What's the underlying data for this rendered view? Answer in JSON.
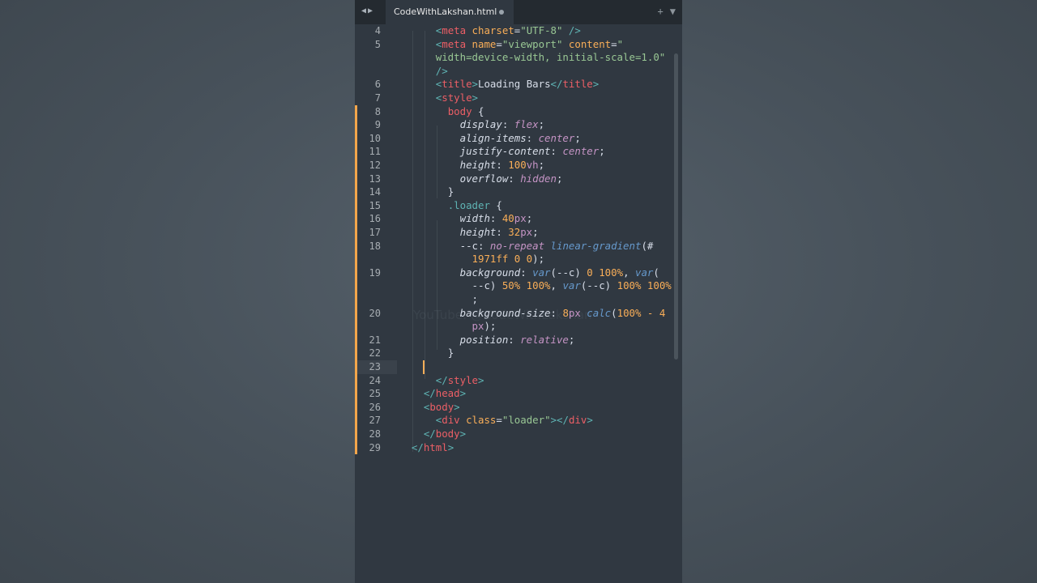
{
  "tab": {
    "filename": "CodeWithLakshan.html"
  },
  "watermark": "YouTube: @CodeWithLakshan",
  "lines": [
    {
      "n": "4",
      "tokens": [
        [
          "      ",
          "w"
        ],
        [
          "<",
          "p"
        ],
        [
          "meta",
          "t"
        ],
        [
          " charset",
          "a"
        ],
        [
          "=",
          "w"
        ],
        [
          "\"UTF-8\"",
          "s"
        ],
        [
          " />",
          "p"
        ]
      ]
    },
    {
      "n": "5",
      "tokens": [
        [
          "      ",
          "w"
        ],
        [
          "<",
          "p"
        ],
        [
          "meta",
          "t"
        ],
        [
          " name",
          "a"
        ],
        [
          "=",
          "w"
        ],
        [
          "\"viewport\"",
          "s"
        ],
        [
          " content",
          "a"
        ],
        [
          "=",
          "w"
        ],
        [
          "\"",
          "s"
        ]
      ]
    },
    {
      "n": "",
      "tokens": [
        [
          "      ",
          "w"
        ],
        [
          "width=device-width, initial-scale=1.0\"",
          "s"
        ]
      ]
    },
    {
      "n": "",
      "tokens": [
        [
          "      ",
          "w"
        ],
        [
          "/>",
          "p"
        ]
      ]
    },
    {
      "n": "6",
      "tokens": [
        [
          "      ",
          "w"
        ],
        [
          "<",
          "p"
        ],
        [
          "title",
          "t"
        ],
        [
          ">",
          "p"
        ],
        [
          "Loading Bars",
          "w"
        ],
        [
          "</",
          "p"
        ],
        [
          "title",
          "t"
        ],
        [
          ">",
          "p"
        ]
      ]
    },
    {
      "n": "7",
      "tokens": [
        [
          "      ",
          "w"
        ],
        [
          "<",
          "p"
        ],
        [
          "style",
          "t"
        ],
        [
          ">",
          "p"
        ]
      ]
    },
    {
      "n": "8",
      "tokens": [
        [
          "        ",
          "w"
        ],
        [
          "body",
          "t"
        ],
        [
          " {",
          "w"
        ]
      ]
    },
    {
      "n": "9",
      "tokens": [
        [
          "          ",
          "w"
        ],
        [
          "display",
          "wi"
        ],
        [
          ": ",
          "w"
        ],
        [
          "flex",
          "ki"
        ],
        [
          ";",
          "w"
        ]
      ]
    },
    {
      "n": "10",
      "tokens": [
        [
          "          ",
          "w"
        ],
        [
          "align-items",
          "wi"
        ],
        [
          ": ",
          "w"
        ],
        [
          "center",
          "ki"
        ],
        [
          ";",
          "w"
        ]
      ]
    },
    {
      "n": "11",
      "tokens": [
        [
          "          ",
          "w"
        ],
        [
          "justify-content",
          "wi"
        ],
        [
          ": ",
          "w"
        ],
        [
          "center",
          "ki"
        ],
        [
          ";",
          "w"
        ]
      ]
    },
    {
      "n": "12",
      "tokens": [
        [
          "          ",
          "w"
        ],
        [
          "height",
          "wi"
        ],
        [
          ": ",
          "w"
        ],
        [
          "100",
          "n"
        ],
        [
          "vh",
          "k"
        ],
        [
          ";",
          "w"
        ]
      ]
    },
    {
      "n": "13",
      "tokens": [
        [
          "          ",
          "w"
        ],
        [
          "overflow",
          "wi"
        ],
        [
          ": ",
          "w"
        ],
        [
          "hidden",
          "ki"
        ],
        [
          ";",
          "w"
        ]
      ]
    },
    {
      "n": "14",
      "tokens": [
        [
          "        ",
          "w"
        ],
        [
          "}",
          "w"
        ]
      ]
    },
    {
      "n": "15",
      "tokens": [
        [
          "        ",
          "w"
        ],
        [
          ".loader",
          "p"
        ],
        [
          " {",
          "w"
        ]
      ]
    },
    {
      "n": "16",
      "tokens": [
        [
          "          ",
          "w"
        ],
        [
          "width",
          "wi"
        ],
        [
          ": ",
          "w"
        ],
        [
          "40",
          "n"
        ],
        [
          "px",
          "k"
        ],
        [
          ";",
          "w"
        ]
      ]
    },
    {
      "n": "17",
      "tokens": [
        [
          "          ",
          "w"
        ],
        [
          "height",
          "wi"
        ],
        [
          ": ",
          "w"
        ],
        [
          "32",
          "n"
        ],
        [
          "px",
          "k"
        ],
        [
          ";",
          "w"
        ]
      ]
    },
    {
      "n": "18",
      "tokens": [
        [
          "          ",
          "w"
        ],
        [
          "--c",
          "w"
        ],
        [
          ": ",
          "w"
        ],
        [
          "no-repeat ",
          "ki"
        ],
        [
          "linear-gradient",
          "fi"
        ],
        [
          "(#",
          "w"
        ]
      ]
    },
    {
      "n": "",
      "tokens": [
        [
          "            ",
          "w"
        ],
        [
          "1971ff 0 0",
          "n"
        ],
        [
          ");",
          "w"
        ]
      ]
    },
    {
      "n": "19",
      "tokens": [
        [
          "          ",
          "w"
        ],
        [
          "background",
          "wi"
        ],
        [
          ": ",
          "w"
        ],
        [
          "var",
          "fi"
        ],
        [
          "(--c) ",
          "w"
        ],
        [
          "0 100%",
          "n"
        ],
        [
          ", ",
          "w"
        ],
        [
          "var",
          "fi"
        ],
        [
          "(",
          "w"
        ]
      ]
    },
    {
      "n": "",
      "tokens": [
        [
          "            ",
          "w"
        ],
        [
          "--c) ",
          "w"
        ],
        [
          "50% 100%",
          "n"
        ],
        [
          ", ",
          "w"
        ],
        [
          "var",
          "fi"
        ],
        [
          "(--c) ",
          "w"
        ],
        [
          "100% 100%",
          "n"
        ]
      ]
    },
    {
      "n": "",
      "tokens": [
        [
          "            ",
          "w"
        ],
        [
          ";",
          "w"
        ]
      ]
    },
    {
      "n": "20",
      "tokens": [
        [
          "          ",
          "w"
        ],
        [
          "background-size",
          "wi"
        ],
        [
          ": ",
          "w"
        ],
        [
          "8",
          "n"
        ],
        [
          "px ",
          "k"
        ],
        [
          "calc",
          "fi"
        ],
        [
          "(",
          "w"
        ],
        [
          "100% - 4",
          "n"
        ]
      ]
    },
    {
      "n": "",
      "tokens": [
        [
          "            ",
          "w"
        ],
        [
          "px",
          "k"
        ],
        [
          ");",
          "w"
        ]
      ]
    },
    {
      "n": "21",
      "tokens": [
        [
          "          ",
          "w"
        ],
        [
          "position",
          "wi"
        ],
        [
          ": ",
          "w"
        ],
        [
          "relative",
          "ki"
        ],
        [
          ";",
          "w"
        ]
      ]
    },
    {
      "n": "22",
      "tokens": [
        [
          "        ",
          "w"
        ],
        [
          "}",
          "w"
        ]
      ]
    },
    {
      "n": "23",
      "tokens": []
    },
    {
      "n": "24",
      "tokens": [
        [
          "      ",
          "w"
        ],
        [
          "</",
          "p"
        ],
        [
          "style",
          "t"
        ],
        [
          ">",
          "p"
        ]
      ]
    },
    {
      "n": "25",
      "tokens": [
        [
          "    ",
          "w"
        ],
        [
          "</",
          "p"
        ],
        [
          "head",
          "t"
        ],
        [
          ">",
          "p"
        ]
      ]
    },
    {
      "n": "26",
      "tokens": [
        [
          "    ",
          "w"
        ],
        [
          "<",
          "p"
        ],
        [
          "body",
          "t"
        ],
        [
          ">",
          "p"
        ]
      ]
    },
    {
      "n": "27",
      "tokens": [
        [
          "      ",
          "w"
        ],
        [
          "<",
          "p"
        ],
        [
          "div",
          "t"
        ],
        [
          " class",
          "a"
        ],
        [
          "=",
          "w"
        ],
        [
          "\"loader\"",
          "s"
        ],
        [
          "></",
          "p"
        ],
        [
          "div",
          "t"
        ],
        [
          ">",
          "p"
        ]
      ]
    },
    {
      "n": "28",
      "tokens": [
        [
          "    ",
          "w"
        ],
        [
          "</",
          "p"
        ],
        [
          "body",
          "t"
        ],
        [
          ">",
          "p"
        ]
      ]
    },
    {
      "n": "29",
      "tokens": [
        [
          "  ",
          "w"
        ],
        [
          "</",
          "p"
        ],
        [
          "html",
          "t"
        ],
        [
          ">",
          "p"
        ]
      ]
    }
  ]
}
